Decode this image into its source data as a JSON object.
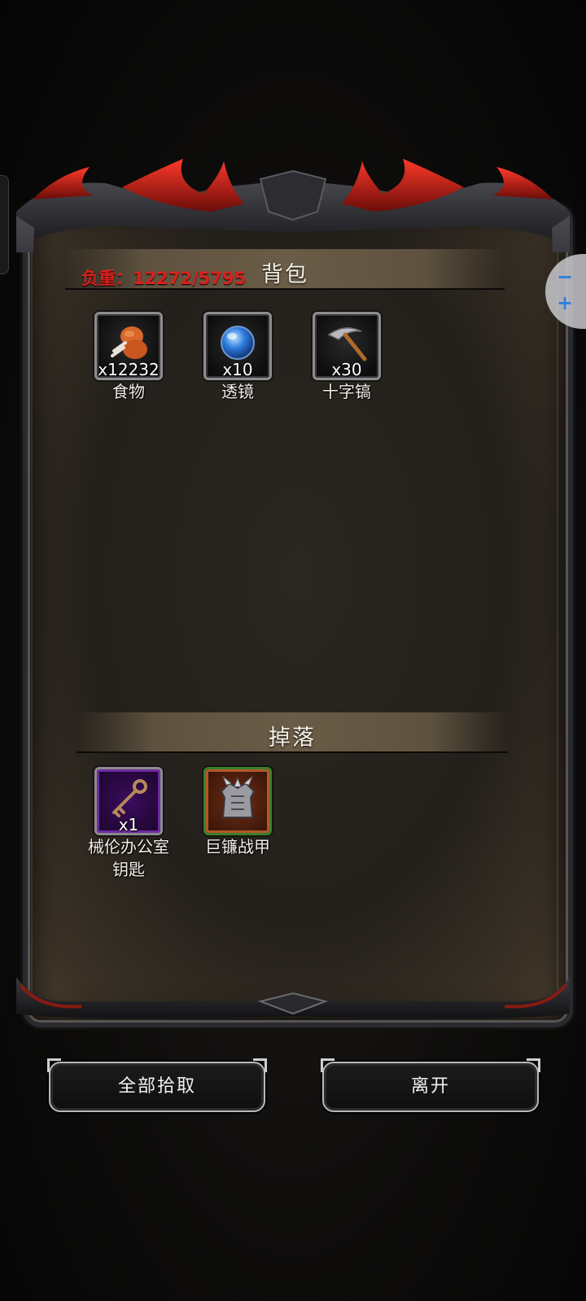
{
  "inventory": {
    "weight_label": "负重：12272/5795",
    "title": "背包",
    "items": [
      {
        "name": "食物",
        "quantity": "x12232",
        "icon": "food-icon"
      },
      {
        "name": "透镜",
        "quantity": "x10",
        "icon": "lens-icon"
      },
      {
        "name": "十字镐",
        "quantity": "x30",
        "icon": "pickaxe-icon"
      }
    ]
  },
  "loot": {
    "title": "掉落",
    "items": [
      {
        "name": "械伦办公室\n钥匙",
        "quantity": "x1",
        "icon": "key-icon",
        "rarity_color": "#6f2aa3"
      },
      {
        "name": "巨镰战甲",
        "quantity": "",
        "icon": "armor-icon",
        "rarity_color": "#b0582a"
      }
    ]
  },
  "buttons": {
    "pickup_all": "全部拾取",
    "leave": "离开"
  },
  "zoom": {
    "minus": "−",
    "plus": "+"
  },
  "colors": {
    "weight_text": "#d9211c",
    "accent_red": "#c0201a"
  }
}
